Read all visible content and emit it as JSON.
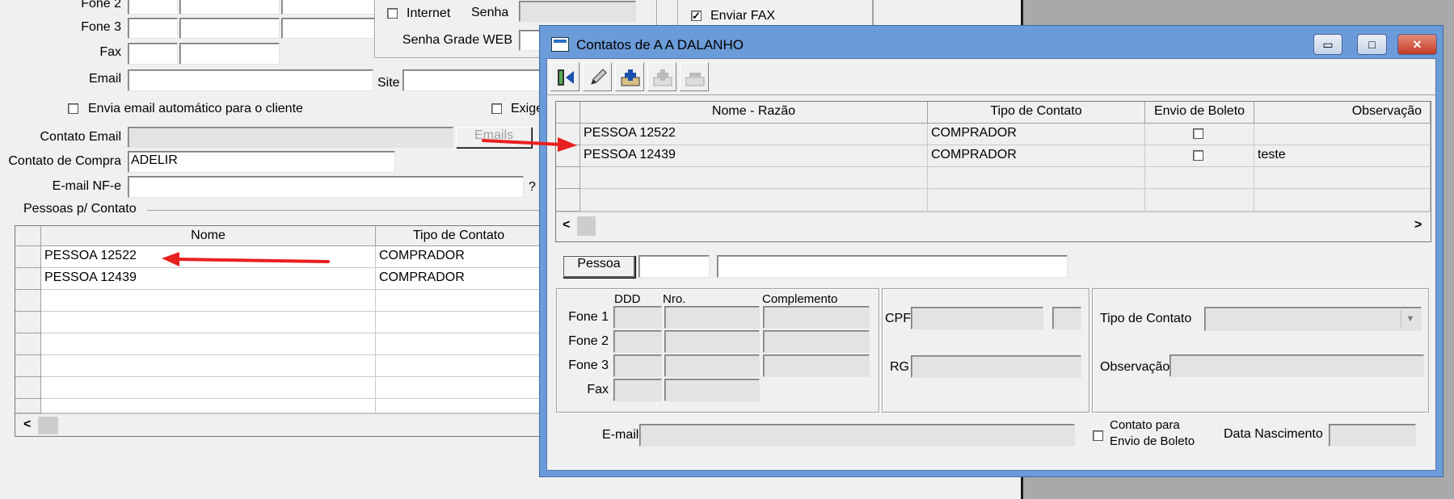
{
  "colors": {
    "title_bar": "#6b9bd8",
    "arrow": "#e8201e",
    "disabled_field": "#e3e3e3"
  },
  "bg": {
    "fone2_label": "Fone 2",
    "fone3_label": "Fone 3",
    "fax_label": "Fax",
    "email_label": "Email",
    "site_label": "Site",
    "internet_label": "Internet",
    "senha_label": "Senha",
    "senha_grade_label": "Senha Grade WEB",
    "enviar_fax_label": "Enviar FAX",
    "envia_email_label": "Envia email automático para o cliente",
    "exige_label": "Exige",
    "contato_email_label": "Contato Email",
    "emails_button": "Emails",
    "contato_compra_label": "Contato de Compra",
    "contato_compra_value": "ADELIR",
    "email_nfe_label": "E-mail NF-e",
    "help_mark": "?",
    "pessoas_group_label": "Pessoas p/ Contato",
    "grid_headers": [
      "Nome",
      "Tipo de Contato"
    ],
    "grid_rows": [
      {
        "nome": "PESSOA 12522",
        "tipo": "COMPRADOR"
      },
      {
        "nome": "PESSOA 12439",
        "tipo": "COMPRADOR"
      }
    ],
    "scroll_left": "<"
  },
  "dialog": {
    "title": "Contatos de  A A DALANHO",
    "min_glyph": "▭",
    "max_glyph": "□",
    "close_glyph": "✕",
    "toolbar": [
      "exit-icon",
      "edit-icon",
      "add-icon",
      "insert-disabled-icon",
      "delete-disabled-icon"
    ],
    "grid_headers": [
      "Nome - Razão",
      "Tipo de Contato",
      "Envio de Boleto",
      "Observação"
    ],
    "grid_rows": [
      {
        "nome": "PESSOA 12522",
        "tipo": "COMPRADOR",
        "boleto": false,
        "obs": ""
      },
      {
        "nome": "PESSOA 12439",
        "tipo": "COMPRADOR",
        "boleto": false,
        "obs": "teste"
      }
    ],
    "scroll_left": "<",
    "scroll_right": ">",
    "pessoa_button": "Pessoa",
    "ddd_header": "DDD",
    "nro_header": "Nro.",
    "complemento_header": "Complemento",
    "fone1_label": "Fone 1",
    "fone2_label": "Fone 2",
    "fone3_label": "Fone 3",
    "fax_label": "Fax",
    "cpf_label": "CPF",
    "rg_label": "RG",
    "tipo_contato_label": "Tipo de Contato",
    "observacao_label": "Observação",
    "email_label": "E-mail",
    "contato_boleto_line1": "Contato para",
    "contato_boleto_line2": "Envio de Boleto",
    "data_nascimento_label": "Data Nascimento"
  }
}
